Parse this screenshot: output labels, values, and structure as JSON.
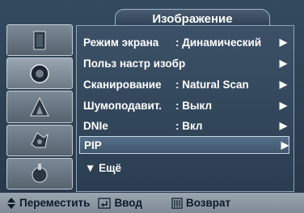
{
  "menu": {
    "title": "Изображение",
    "items": [
      {
        "label": "Режим экрана",
        "value": ": Динамический",
        "arrow": "▶",
        "selected": false
      },
      {
        "label": "Польз настр изобр",
        "value": "",
        "arrow": "▶",
        "selected": false
      },
      {
        "label": "Сканирование",
        "value": ": Natural Scan",
        "arrow": "▶",
        "selected": false
      },
      {
        "label": "Шумоподавит.",
        "value": ": Выкл",
        "arrow": "▶",
        "selected": false
      },
      {
        "label": "DNIe",
        "value": ": Вкл",
        "arrow": "▶",
        "selected": false
      },
      {
        "label": "PIP",
        "value": "",
        "arrow": "▶",
        "selected": true
      }
    ],
    "more_label": "▼ Ещё"
  },
  "sidebar": {
    "icons": [
      "input-icon",
      "picture-icon",
      "sound-icon",
      "channel-icon",
      "setup-icon"
    ]
  },
  "help": {
    "move": "Переместить",
    "enter": "Ввод",
    "return": "Возврат"
  },
  "colors": {
    "panel": "#33485c",
    "help_bar": "#8c97a2",
    "text": "#ffffff"
  }
}
